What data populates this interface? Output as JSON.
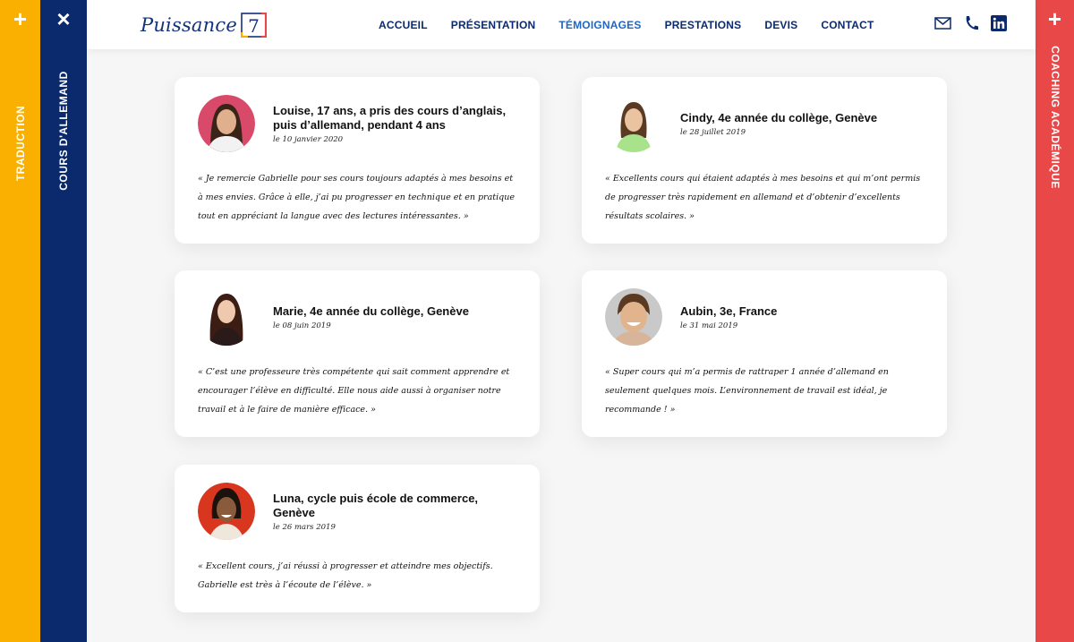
{
  "side": {
    "left_yellow": {
      "control": "+",
      "label": "TRADUCTION"
    },
    "left_blue": {
      "control": "×",
      "label": "COURS D'ALLEMAND"
    },
    "right_red": {
      "control": "+",
      "label": "COACHING ACADÉMIQUE"
    }
  },
  "header": {
    "logo_text": "Puissance",
    "logo_mark": "7",
    "nav": [
      "ACCUEIL",
      "PRÉSENTATION",
      "TÉMOIGNAGES",
      "PRESTATIONS",
      "DEVIS",
      "CONTACT"
    ],
    "active_nav": "TÉMOIGNAGES",
    "icons": [
      "mail-icon",
      "phone-icon",
      "linkedin-icon"
    ]
  },
  "colors": {
    "yellow": "#f9b000",
    "navy": "#0b2a6d",
    "red": "#e94848",
    "active_link": "#2066c4"
  },
  "testimonials": [
    {
      "name": "Louise, 17 ans, a pris des cours d’anglais, puis d’allemand, pendant 4 ans",
      "date": "le 10 janvier 2020",
      "quote": "« Je remercie Gabrielle pour ses cours toujours adaptés à mes besoins et à mes envies. Grâce à elle, j’ai pu progresser en technique et en pratique tout en appréciant la langue avec des lectures intéressantes. »",
      "avatar_bg": "#d94a6a"
    },
    {
      "name": "Cindy, 4e année du collège, Genève",
      "date": "le 28 juillet 2019",
      "quote": "« Excellents cours qui étaient adaptés à mes besoins et qui m’ont permis de progresser très rapidement en allemand et d’obtenir d’excellents résultats scolaires. »",
      "avatar_bg": "#ffffff"
    },
    {
      "name": "Marie, 4e année du collège, Genève",
      "date": "le 08 juin 2019",
      "quote": "« C’est une professeure très compétente qui sait comment apprendre et encourager l’élève en difficulté. Elle nous aide aussi à organiser notre travail et à le faire de manière efficace. »",
      "avatar_bg": "#ffffff"
    },
    {
      "name": "Aubin, 3e, France",
      "date": "le 31 mai 2019",
      "quote": "« Super cours qui m’a permis de rattraper 1 année d’allemand en seulement quelques mois. L’environnement de travail est idéal, je recommande ! »",
      "avatar_bg": "#c9c9c9"
    },
    {
      "name": "Luna, cycle puis école de commerce, Genève",
      "date": "le 26 mars 2019",
      "quote": "« Excellent cours, j’ai réussi à progresser et atteindre mes objectifs. Gabrielle est très à l’écoute de l’élève.  »",
      "avatar_bg": "#d9361f"
    }
  ]
}
